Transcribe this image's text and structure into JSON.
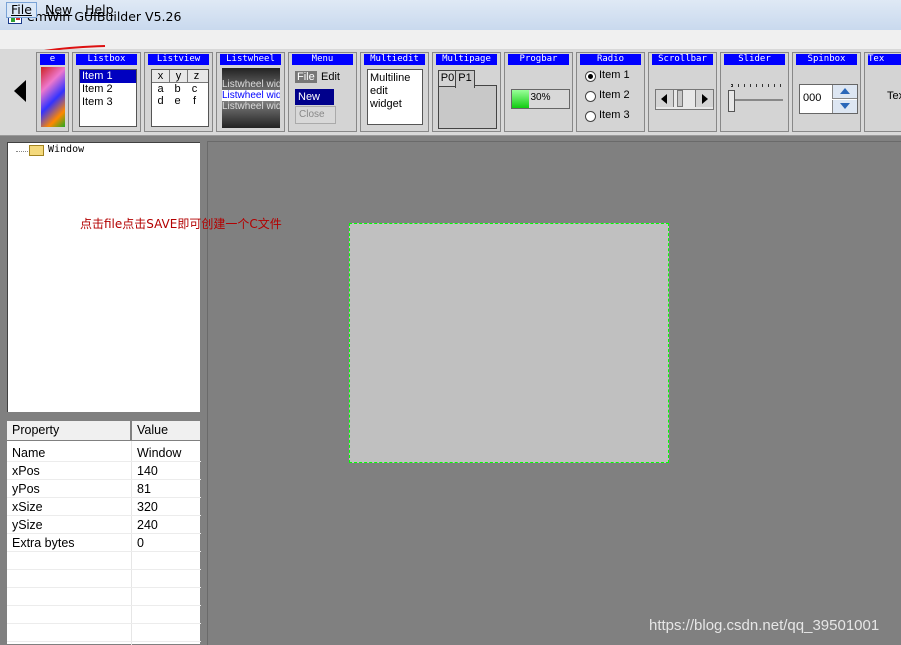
{
  "window": {
    "title": "emWin GUIBuilder V5.26"
  },
  "menu": {
    "items": [
      "File",
      "New",
      "Help"
    ]
  },
  "toolbar": {
    "widgets": [
      "e",
      "Listbox",
      "Listview",
      "Listwheel",
      "Menu",
      "Multiedit",
      "Multipage",
      "Progbar",
      "Radio",
      "Scrollbar",
      "Slider",
      "Spinbox",
      "Tex"
    ],
    "listbox_items": [
      "Item 1",
      "Item 2",
      "Item 3"
    ],
    "listview": {
      "headers": [
        "x",
        "y",
        "z"
      ],
      "rows": [
        [
          "a",
          "b",
          "c"
        ],
        [
          "d",
          "e",
          "f"
        ]
      ]
    },
    "listwheel_text": "Listwheel wid",
    "menu_preview": {
      "file": "File",
      "edit": "Edit",
      "new": "New",
      "close": "Close"
    },
    "multiedit_lines": [
      "Multiline",
      "edit",
      "widget"
    ],
    "multipage_tabs": [
      "P0",
      "P1"
    ],
    "progbar_value": "30%",
    "radio_items": [
      "Item 1",
      "Item 2",
      "Item 3"
    ],
    "spinbox_value": "000",
    "text_preview": "Tex"
  },
  "tree": {
    "root": "Window"
  },
  "properties": {
    "headers": {
      "property": "Property",
      "value": "Value"
    },
    "rows": [
      {
        "name": "Name",
        "value": "Window"
      },
      {
        "name": "xPos",
        "value": "140"
      },
      {
        "name": "yPos",
        "value": "81"
      },
      {
        "name": "xSize",
        "value": "320"
      },
      {
        "name": "ySize",
        "value": "240"
      },
      {
        "name": "Extra bytes",
        "value": "0"
      }
    ]
  },
  "annotation": "点击file点击SAVE即可创建一个C文件",
  "watermark": "https://blog.csdn.net/qq_39501001",
  "colors": {
    "label_blue": "#0000ff",
    "annotation_red": "#b30000",
    "window_border": "#00ff00",
    "canvas": "#808080"
  }
}
